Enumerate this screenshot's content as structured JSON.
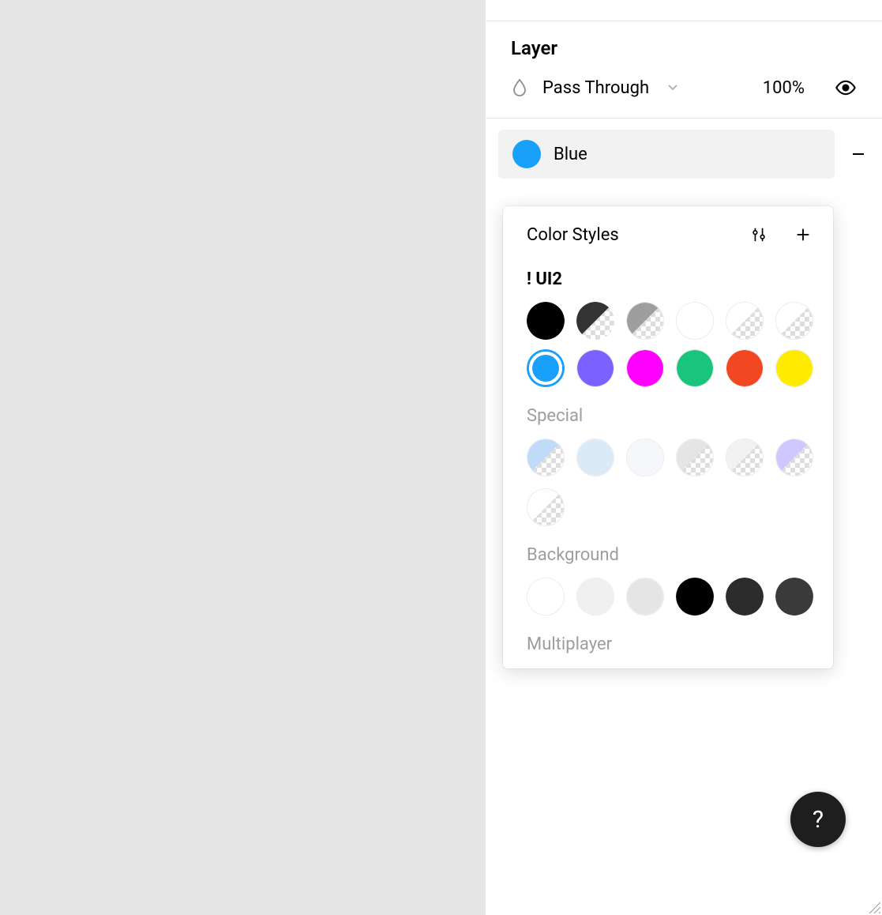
{
  "layer": {
    "section_title": "Layer",
    "blend_mode": "Pass Through",
    "opacity": "100%"
  },
  "fill": {
    "chip_color": "#18a0fb",
    "chip_label": "Blue"
  },
  "popover": {
    "title": "Color Styles",
    "group_ui2": "! UI2",
    "ui2_swatches_row1": [
      {
        "name": "black",
        "color": "#000000",
        "alpha": null
      },
      {
        "name": "dark-grey",
        "color": "#333333",
        "alpha": true
      },
      {
        "name": "grey",
        "color": "#9e9e9e",
        "alpha": true
      },
      {
        "name": "white",
        "color": "#ffffff",
        "alpha": null
      },
      {
        "name": "white-80",
        "color": "#ffffff",
        "alpha": true
      },
      {
        "name": "white-60",
        "color": "#ffffff",
        "alpha": true
      }
    ],
    "ui2_swatches_row2": [
      {
        "name": "blue",
        "color": "#18a0fb",
        "selected": true
      },
      {
        "name": "purple",
        "color": "#7b61ff"
      },
      {
        "name": "magenta",
        "color": "#ff00ff"
      },
      {
        "name": "green",
        "color": "#1bc47d"
      },
      {
        "name": "red-orange",
        "color": "#f24822"
      },
      {
        "name": "yellow",
        "color": "#ffeb00"
      }
    ],
    "group_special": "Special",
    "special_swatches": [
      {
        "name": "light-blue",
        "color": "#bfdbf7",
        "alpha": true
      },
      {
        "name": "pale-blue",
        "color": "#daeaf7"
      },
      {
        "name": "hover-grey",
        "color": "#f5f7fa"
      },
      {
        "name": "grey-alpha-40",
        "color": "#e5e5e5",
        "alpha": true
      },
      {
        "name": "grey-alpha-20",
        "color": "#f2f2f2",
        "alpha": true
      },
      {
        "name": "lavender",
        "color": "#cfc8ff",
        "alpha": true
      },
      {
        "name": "white-alpha",
        "color": "#ffffff",
        "alpha": true
      }
    ],
    "group_background": "Background",
    "background_swatches": [
      {
        "name": "bg-white",
        "color": "#ffffff"
      },
      {
        "name": "bg-grey-1",
        "color": "#f0f0f0"
      },
      {
        "name": "bg-grey-2",
        "color": "#e5e5e5"
      },
      {
        "name": "bg-black",
        "color": "#000000"
      },
      {
        "name": "bg-charcoal",
        "color": "#2c2c2c"
      },
      {
        "name": "bg-dark-grey",
        "color": "#3a3a3a"
      }
    ],
    "group_multiplayer": "Multiplayer"
  },
  "help": {
    "label": "?"
  }
}
